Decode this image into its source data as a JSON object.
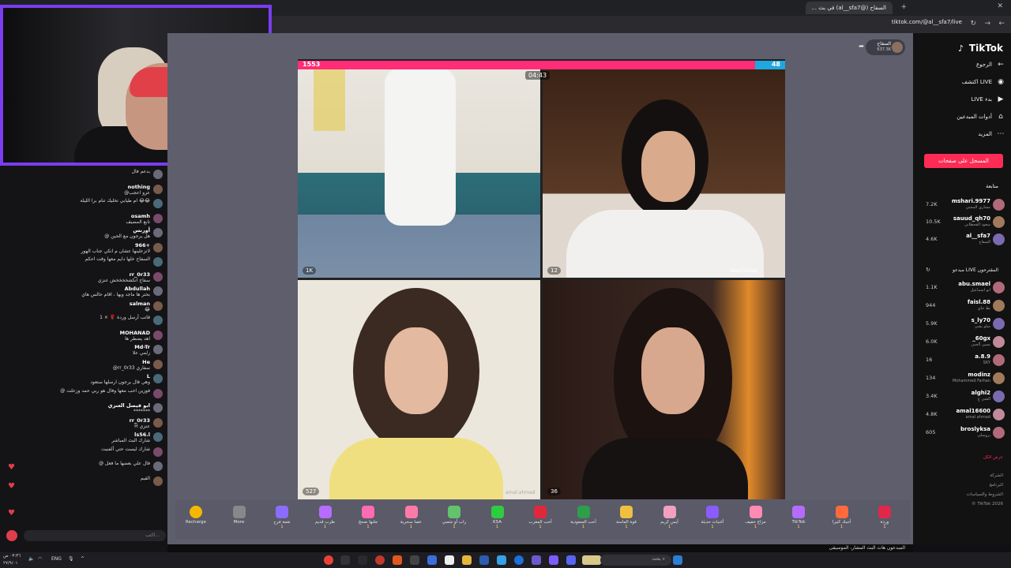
{
  "browser": {
    "tab_title": "السفاح (@al__sfa7) في بث ...",
    "url": "tiktok.com/@al__sfa7/live"
  },
  "live": {
    "host_name": "السفاح",
    "host_likes": "637.3K",
    "left_score": "1553",
    "right_score": "48",
    "timer": "04:43",
    "cell_counts": [
      "1K",
      "12",
      "527",
      "36"
    ],
    "cell_names": [
      "Nouf Fahad",
      "amal ahmad"
    ],
    "cell_extra": "عرض الكل"
  },
  "gifts": [
    {
      "label": "Recharge",
      "price": ""
    },
    {
      "label": "More",
      "price": ""
    },
    {
      "label": "نغمة فرح",
      "price": "1"
    },
    {
      "label": "طرب قديم",
      "price": "1"
    },
    {
      "label": "جلنها ضحخ",
      "price": "1"
    },
    {
      "label": "عصا سحرية",
      "price": "1"
    },
    {
      "label": "راب أو شعبي",
      "price": "1"
    },
    {
      "label": "KSA",
      "price": "1"
    },
    {
      "label": "أحب المغرب",
      "price": "1"
    },
    {
      "label": "أحب السعودية",
      "price": "1"
    },
    {
      "label": "قوة الماسة",
      "price": "1"
    },
    {
      "label": "آيس كريم",
      "price": "1"
    },
    {
      "label": "أغنيات حديثة",
      "price": "1"
    },
    {
      "label": "مزاج خفيف",
      "price": "1"
    },
    {
      "label": "TikTok",
      "price": "1"
    },
    {
      "label": "أحبك كثيرا",
      "price": "1"
    },
    {
      "label": "وردة",
      "price": "1"
    }
  ],
  "chat": [
    {
      "user": "",
      "text": "بدعم فال"
    },
    {
      "user": "nothing",
      "text": "@عزو اعجب"
    },
    {
      "user": "",
      "text": "ام طيابي تخليك تنام برا الليلة 😂😂"
    },
    {
      "user": "osamh",
      "text": "تابع المضيف"
    },
    {
      "user": "أورنس",
      "text": "@ هل يرجون مع الحين"
    },
    {
      "user": "966+",
      "text": "لاتزعلينها عشان م انكي جناب الهور"
    },
    {
      "user": "",
      "text": "السفاح خلها دايم معها وقت احكم"
    },
    {
      "user": "rr_0r33",
      "text": "سفاح انكشخخخخش عنزي"
    },
    {
      "user": "Abdullah",
      "text": "بحتر ها ماجد ويها ، اقام حالس هاي"
    },
    {
      "user": "salman",
      "text": "😂"
    },
    {
      "user": "",
      "text": "قاتب أرسل وردة 🌹 × 1"
    },
    {
      "user": "MOHANAD",
      "text": "اهد يضطر ها"
    },
    {
      "user": "Md-Tr",
      "text": "زلمي علا"
    },
    {
      "user": "He",
      "text": "@rr_0r33 سفاري"
    },
    {
      "user": "L",
      "text": "وهي فال يرجون ارسلها ستعود"
    },
    {
      "user": "",
      "text": "@ فوزين احب معها وفال هو ربي حمد وزعلت"
    },
    {
      "user": "ابو فيصل العنزي",
      "text": "*******"
    },
    {
      "user": "rr_0r33",
      "text": "H عنزي"
    },
    {
      "user": "ls56.l",
      "text": "شارك البث المباشر"
    },
    {
      "user": "",
      "text": "شارك ليست حتي ألفنيت"
    },
    {
      "user": "",
      "text": "@ فال علي بعضها ما فعل"
    },
    {
      "user": "",
      "text": "القيم"
    }
  ],
  "chat_input_placeholder": "اكتب...",
  "sidebar": {
    "logo": "TikTok",
    "nav": [
      "الرجوع",
      "اكتشف LIVE",
      "LIVE بدء",
      "أدوات المبدعين",
      "المزيد"
    ],
    "follow_button": "المسجل على صفحات",
    "following_title": "متابعة",
    "following": [
      {
        "name": "mshari.9977",
        "sub": "مشاري المحبي",
        "count": "7.2K"
      },
      {
        "name": "sauud_qh70",
        "sub": "سعود القحطاني",
        "count": "10.5K"
      },
      {
        "name": "al__sfa7",
        "sub": "السفاح",
        "count": "4.6K"
      }
    ],
    "suggested_title": "مبدعو LIVE المقترحون",
    "suggested": [
      {
        "name": "abu.smael",
        "sub": "ابو اسماعيل",
        "count": "1.1K"
      },
      {
        "name": "faisl.88",
        "sub": "بط جاي",
        "count": "944"
      },
      {
        "name": "s_ly70",
        "sub": "سلو يشي",
        "count": "5.9K"
      },
      {
        "name": "_60gx",
        "sub": "نسين ألحبي",
        "count": "6.0K"
      },
      {
        "name": "a.8.9",
        "sub": "SKY",
        "count": "16"
      },
      {
        "name": "modinz",
        "sub": "Mohammed Farhan",
        "count": "134"
      },
      {
        "name": "alghi2",
        "sub": "الشي ع",
        "count": "3.4K"
      },
      {
        "name": "amal16600",
        "sub": "amal ahmad",
        "count": "4.8K"
      },
      {
        "name": "broslyksa",
        "sub": "بروسلي",
        "count": "605"
      }
    ],
    "see_all": "عرض الكل",
    "footer": [
      "الشركة",
      "البرنامج",
      "الشروط والسياسات",
      "© TikTok 2026"
    ]
  },
  "below_stream": "المبدعون هات البث المشار، الموسيقى",
  "taskbar": {
    "search": "بحث",
    "lang": "ENG",
    "time": "٠٣:٣٦ ص",
    "date": "٢٧/٩/٠١"
  }
}
